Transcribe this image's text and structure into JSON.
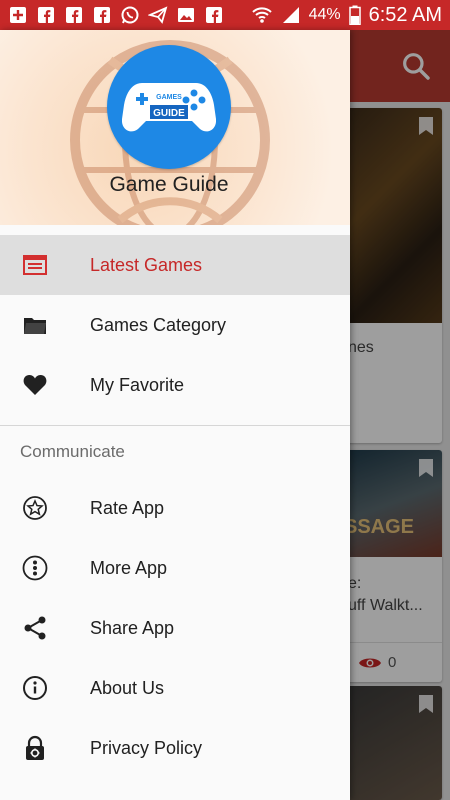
{
  "status_bar": {
    "battery": "44%",
    "time": "6:52 AM",
    "icons": [
      "plus-box-icon",
      "facebook-icon",
      "facebook-icon",
      "facebook-icon",
      "whatsapp-icon",
      "send-icon",
      "image-icon",
      "facebook-icon"
    ]
  },
  "drawer": {
    "app_name": "Game Guide",
    "logo_text_top": "GAMES",
    "logo_text_bottom": "GUIDE",
    "items": [
      {
        "label": "Latest Games",
        "icon": "calendar-icon",
        "active": true
      },
      {
        "label": "Games Category",
        "icon": "folder-icon"
      },
      {
        "label": "My Favorite",
        "icon": "heart-icon"
      }
    ],
    "section_title": "Communicate",
    "communicate_items": [
      {
        "label": "Rate App",
        "icon": "star-icon"
      },
      {
        "label": "More App",
        "icon": "more-vertical-icon"
      },
      {
        "label": "Share App",
        "icon": "share-icon"
      },
      {
        "label": "About Us",
        "icon": "info-icon"
      },
      {
        "label": "Privacy Policy",
        "icon": "lock-icon"
      }
    ]
  },
  "background": {
    "card1_text": "nes",
    "card2_line1": "e:",
    "card2_line2": "uff Walkt...",
    "card2_views": "0",
    "card2_thumb_text": "SSAGE",
    "colors": {
      "toolbar": "#b83a31",
      "accent": "#c62828"
    }
  }
}
